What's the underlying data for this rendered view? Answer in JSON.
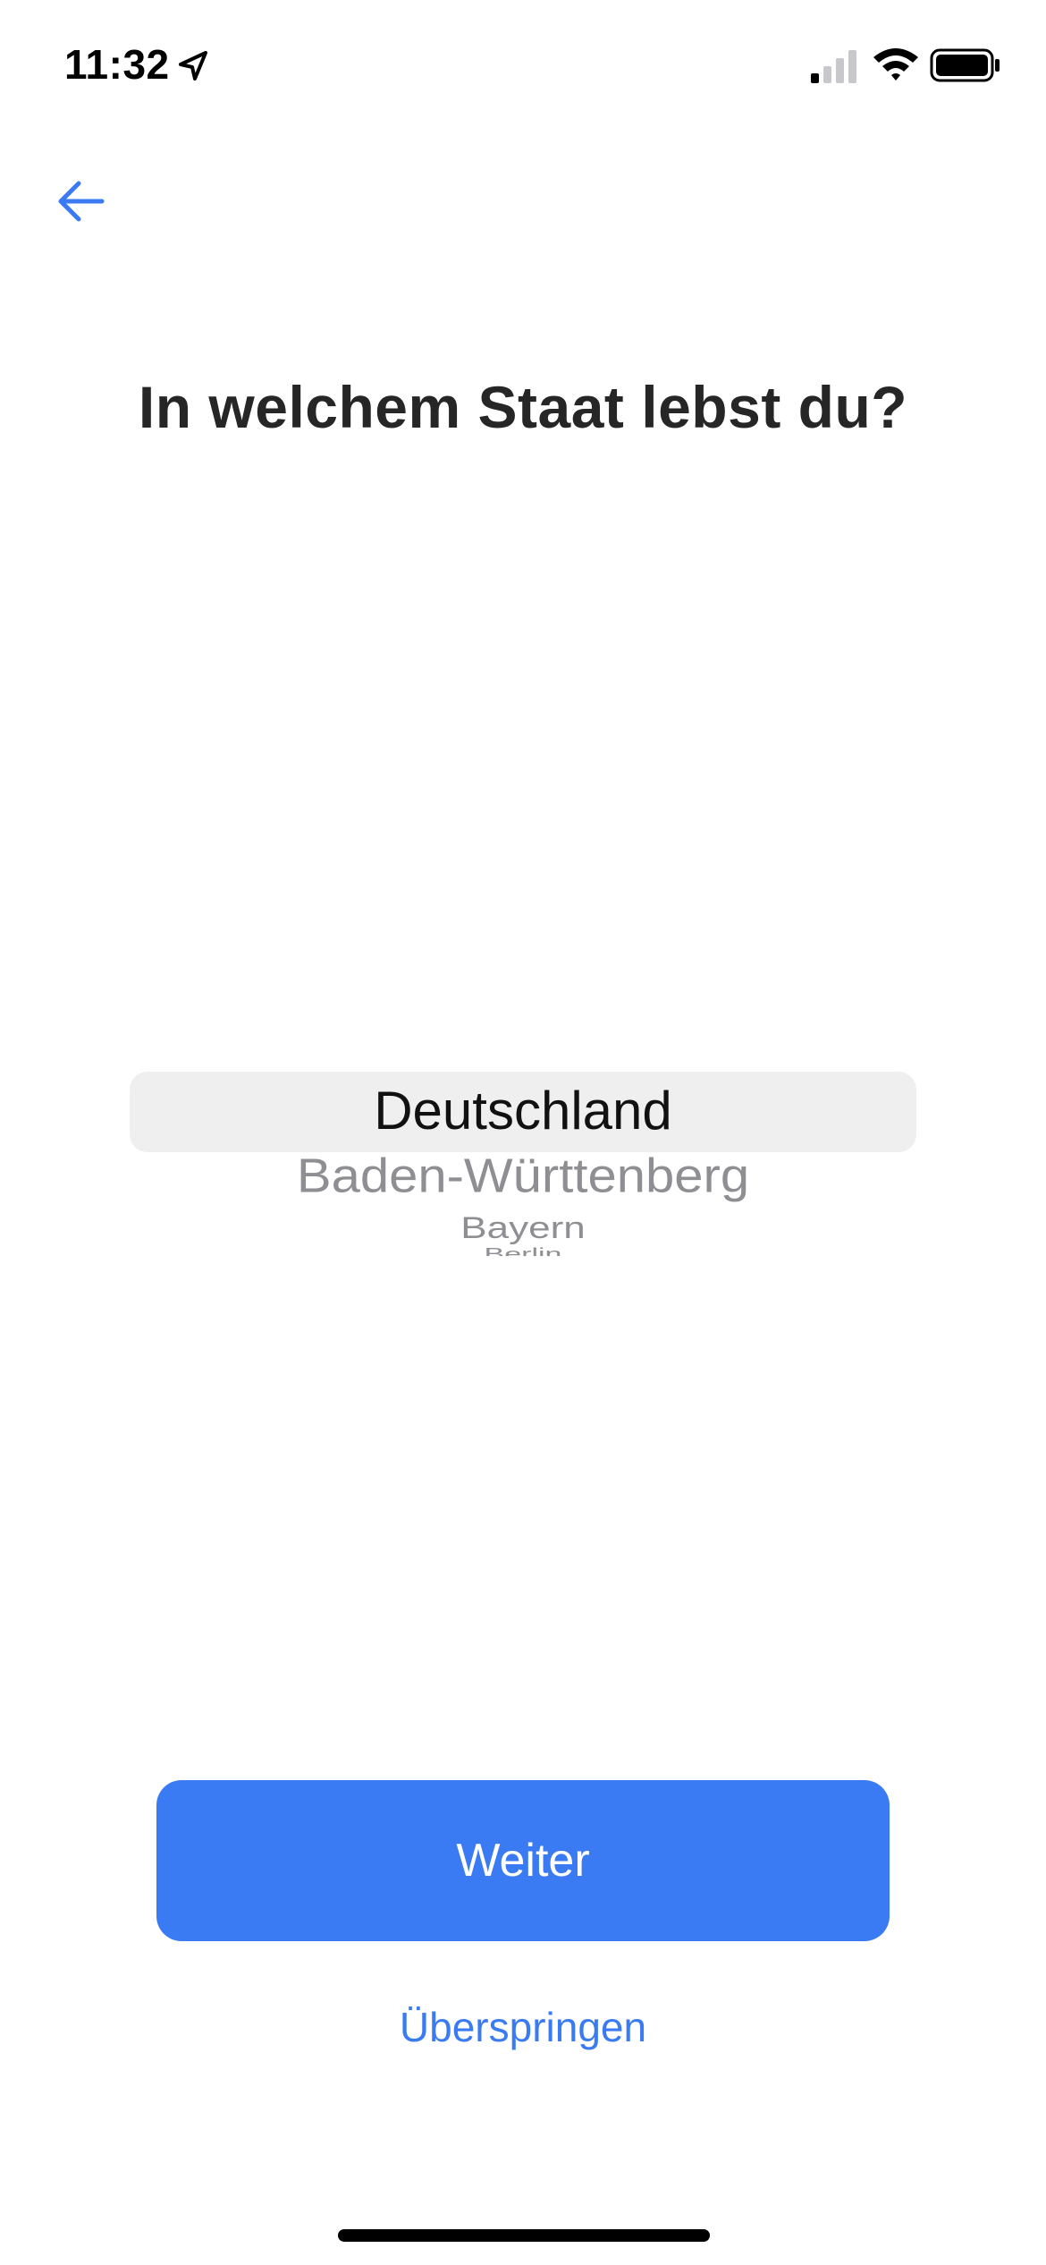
{
  "status_bar": {
    "time": "11:32",
    "icons": [
      "location-arrow-icon",
      "cellular-signal-icon",
      "wifi-icon",
      "battery-icon"
    ]
  },
  "nav": {
    "back_icon": "arrow-left-icon"
  },
  "title": "In welchem Staat lebst du?",
  "picker": {
    "selected": "Deutschland",
    "items": [
      "Baden-Württenberg",
      "Bayern",
      "Berlin"
    ]
  },
  "actions": {
    "primary_label": "Weiter",
    "skip_label": "Überspringen"
  },
  "colors": {
    "accent": "#3a7bf3",
    "title": "#262626",
    "picker_highlight": "#efefef",
    "picker_muted": "#8e8e93"
  }
}
